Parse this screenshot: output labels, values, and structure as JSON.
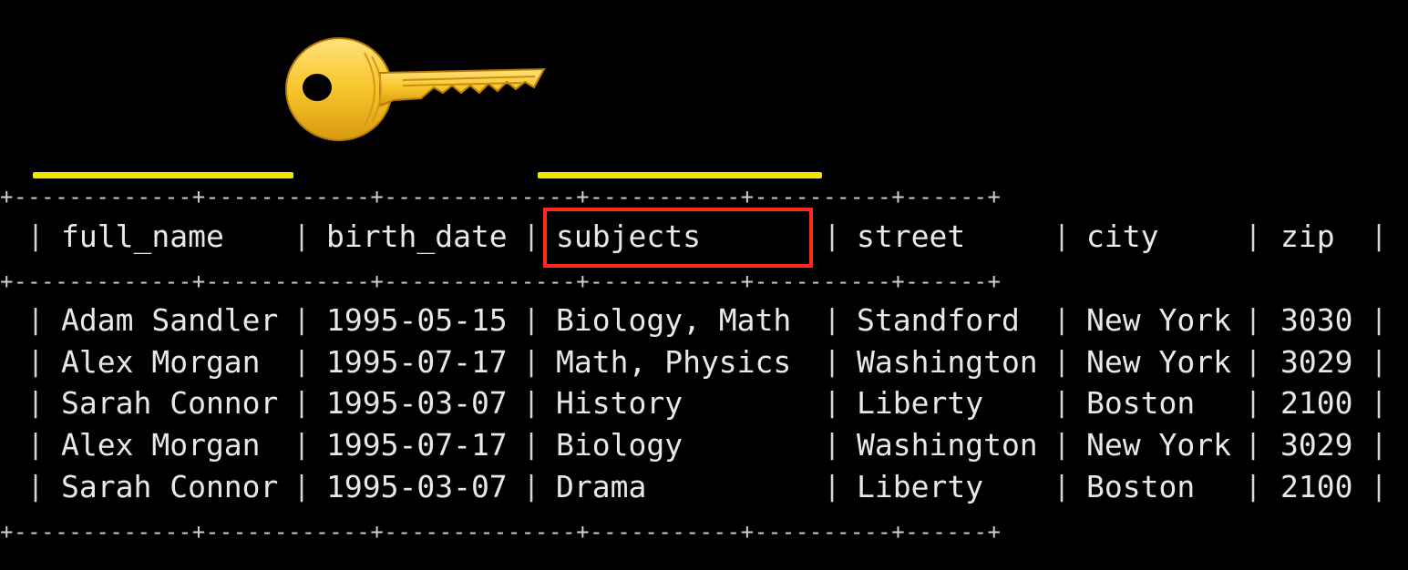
{
  "table": {
    "border_line": "+-------------+------------+--------------+-----------+----------+------+",
    "columns": [
      "full_name",
      "birth_date",
      "subjects",
      "street",
      "city",
      "zip"
    ],
    "rows": [
      [
        "Adam Sandler",
        "1995-05-15",
        "Biology, Math",
        "Standford",
        "New York",
        "3030"
      ],
      [
        "Alex Morgan",
        "1995-07-17",
        "Math, Physics",
        "Washington",
        "New York",
        "3029"
      ],
      [
        "Sarah Connor",
        "1995-03-07",
        "History",
        "Liberty",
        "Boston",
        "2100"
      ],
      [
        "Alex Morgan",
        "1995-07-17",
        "Biology",
        "Washington",
        "New York",
        "3029"
      ],
      [
        "Sarah Connor",
        "1995-03-07",
        "Drama",
        "Liberty",
        "Boston",
        "2100"
      ]
    ]
  },
  "annotations": {
    "key_icon": "key-icon",
    "underline_color": "#f2e600",
    "highlight_color": "#ff2a1a",
    "highlighted_column": "subjects"
  }
}
